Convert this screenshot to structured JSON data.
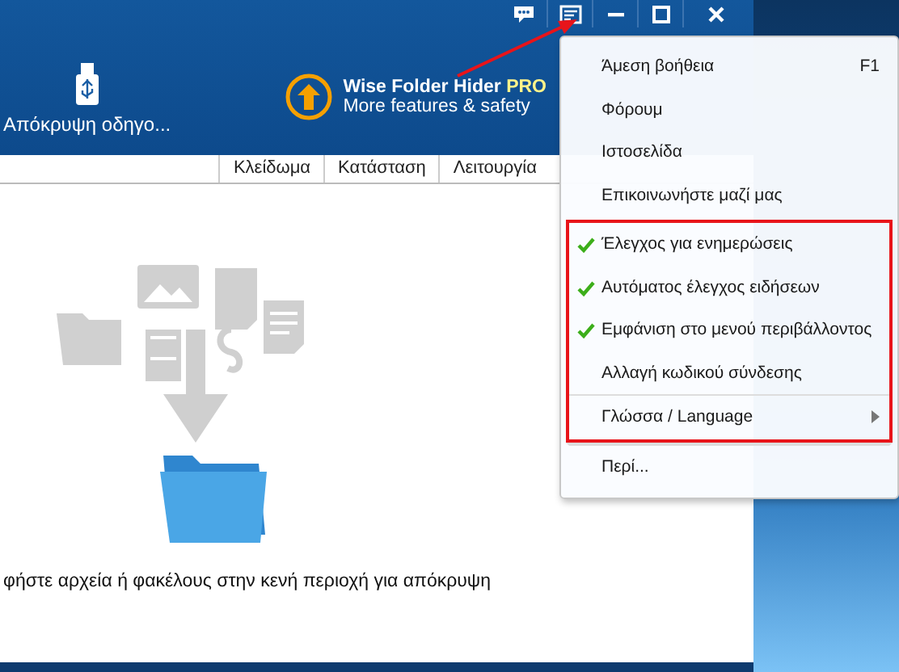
{
  "toolbar": {
    "drive_button": {
      "label": "Απόκρυψη οδηγο..."
    },
    "promo": {
      "title": "Wise Folder Hider",
      "badge": "PRO",
      "subtitle": "More features & safety"
    }
  },
  "table": {
    "columns": [
      "Κλείδωμα",
      "Κατάσταση",
      "Λειτουργία"
    ]
  },
  "empty_hint": "φήστε αρχεία ή φακέλους στην κενή περιοχή για απόκρυψη",
  "menu": {
    "sections": [
      {
        "highlighted": false,
        "items": [
          {
            "label": "Άμεση βοήθεια",
            "shortcut": "F1",
            "checked": false,
            "submenu": false,
            "divider_above": false
          },
          {
            "label": "Φόρουμ",
            "checked": false,
            "submenu": false,
            "divider_above": false
          },
          {
            "label": "Ιστοσελίδα",
            "checked": false,
            "submenu": false,
            "divider_above": false
          },
          {
            "label": "Επικοινωνήστε μαζί μας",
            "checked": false,
            "submenu": false,
            "divider_above": false
          }
        ]
      },
      {
        "highlighted": true,
        "items": [
          {
            "label": "Έλεγχος για ενημερώσεις",
            "checked": true,
            "submenu": false,
            "divider_above": false
          },
          {
            "label": "Αυτόματος έλεγχος ειδήσεων",
            "checked": true,
            "submenu": false,
            "divider_above": false
          },
          {
            "label": "Εμφάνιση στο μενού περιβάλλοντος",
            "checked": true,
            "submenu": false,
            "divider_above": false
          },
          {
            "label": "Αλλαγή κωδικού σύνδεσης",
            "checked": false,
            "submenu": false,
            "divider_above": false
          },
          {
            "label": "Γλώσσα / Language",
            "checked": false,
            "submenu": true,
            "divider_above": true
          }
        ]
      },
      {
        "highlighted": false,
        "items": [
          {
            "label": "Περί...",
            "checked": false,
            "submenu": false,
            "divider_above": false
          }
        ]
      }
    ]
  }
}
